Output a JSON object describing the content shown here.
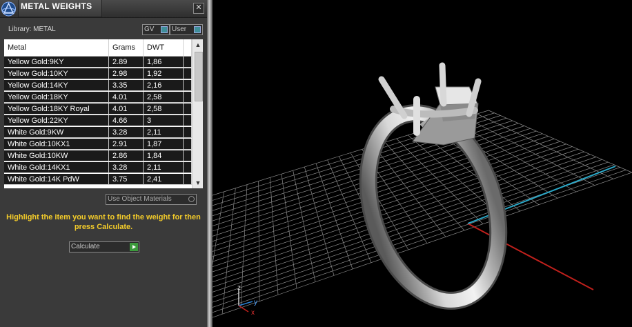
{
  "window": {
    "title": "METAL WEIGHTS",
    "close_glyph": "✕"
  },
  "icons": {
    "app": "app-logo-icon",
    "close": "close-icon",
    "toggle": "toggle-icon",
    "play": "play-icon",
    "scroll_up": "chevron-up-icon",
    "scroll_down": "chevron-down-icon"
  },
  "library": {
    "label": "Library:",
    "value": "METAL"
  },
  "toggles": {
    "gv": "GV",
    "user": "User"
  },
  "table": {
    "columns": [
      "Metal",
      "Grams",
      "DWT"
    ],
    "rows": [
      [
        "Yellow Gold:9KY",
        "2.89",
        "1,86"
      ],
      [
        "Yellow Gold:10KY",
        "2.98",
        "1,92"
      ],
      [
        "Yellow Gold:14KY",
        "3.35",
        "2,16"
      ],
      [
        "Yellow Gold:18KY",
        "4.01",
        "2,58"
      ],
      [
        "Yellow Gold:18KY Royal",
        "4.01",
        "2,58"
      ],
      [
        "Yellow Gold:22KY",
        "4.66",
        "3"
      ],
      [
        "White Gold:9KW",
        "3.28",
        "2,11"
      ],
      [
        "White Gold:10KX1",
        "2.91",
        "1,87"
      ],
      [
        "White Gold:10KW",
        "2.86",
        "1,84"
      ],
      [
        "White Gold:14KX1",
        "3.28",
        "2,11"
      ],
      [
        "White Gold:14K PdW",
        "3.75",
        "2,41"
      ]
    ]
  },
  "use_object_materials": "Use Object Materials",
  "instruction": "Highlight the item you want to find the weight for then press Calculate.",
  "calculate_label": "Calculate",
  "axis_gizmo": {
    "z": "z",
    "y": "y",
    "x": "x"
  },
  "colors": {
    "instruction": "#f4cc2a",
    "axis_x": "#c0201c",
    "axis_y": "#2aa8c8",
    "grid": "#8a8a8a"
  }
}
